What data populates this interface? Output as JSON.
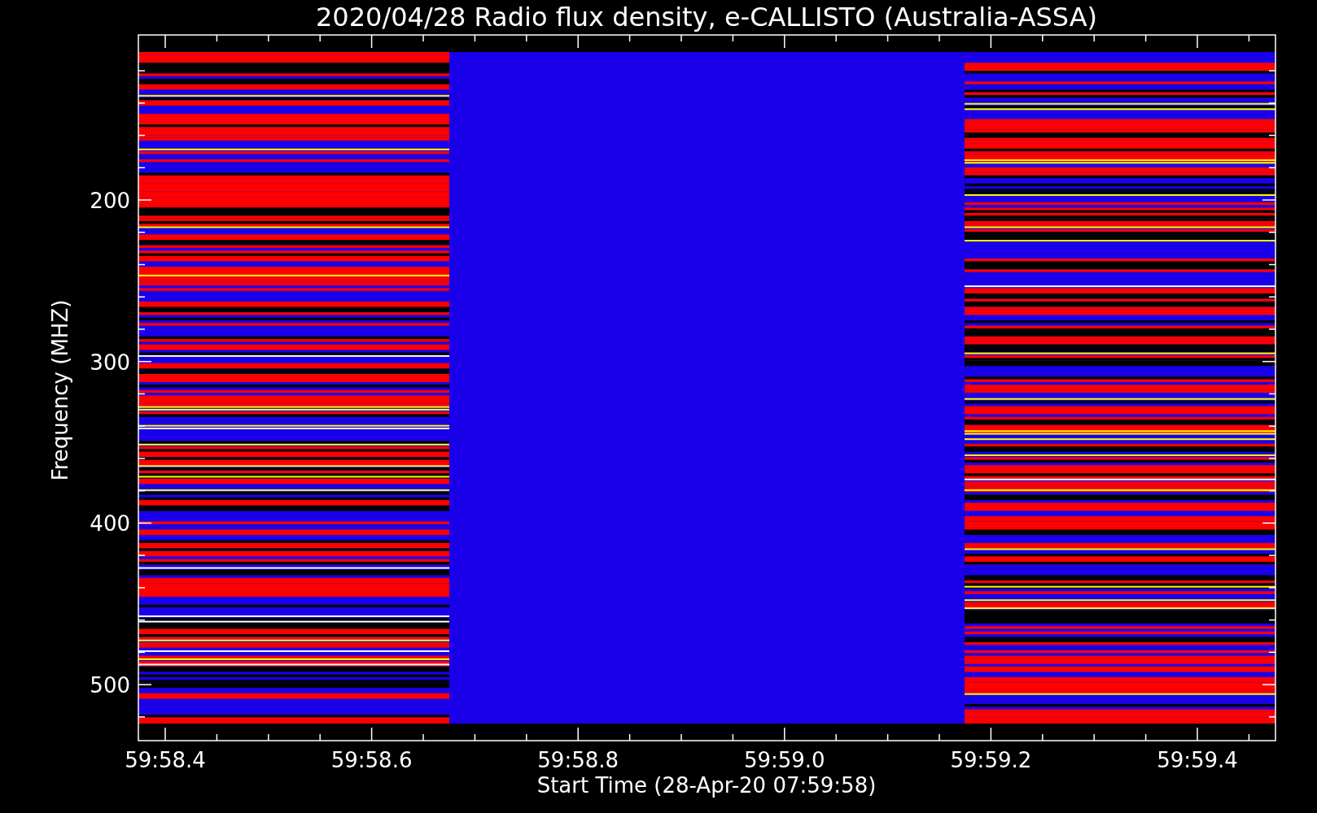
{
  "title": "2020/04/28  Radio flux density, e-CALLISTO (Australia-ASSA)",
  "x_axis": {
    "label": "Start Time (28-Apr-20 07:59:58)",
    "ticks": [
      "59:58.4",
      "59:58.6",
      "59:58.8",
      "59:59.0",
      "59:59.2",
      "59:59.4"
    ]
  },
  "y_axis": {
    "label": "Frequency (MHZ)",
    "ticks": [
      "200",
      "300",
      "400",
      "500"
    ]
  }
}
